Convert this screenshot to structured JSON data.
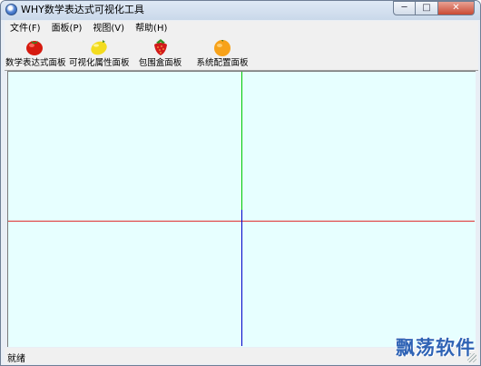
{
  "window": {
    "title": "WHY数学表达式可视化工具"
  },
  "title_buttons": {
    "minimize": "─",
    "maximize": "□",
    "close": "✕"
  },
  "menu": [
    {
      "label": "文件(F)"
    },
    {
      "label": "面板(P)"
    },
    {
      "label": "视图(V)"
    },
    {
      "label": "帮助(H)"
    }
  ],
  "toolbar": [
    {
      "label": "数学表达式面板",
      "icon": "tomato-icon"
    },
    {
      "label": "可视化属性面板",
      "icon": "lemon-icon"
    },
    {
      "label": "包围盒面板",
      "icon": "strawberry-icon"
    },
    {
      "label": "系统配置面板",
      "icon": "orange-icon"
    }
  ],
  "canvas": {
    "background": "#e7ffff",
    "axis_colors": {
      "x": "#e03030",
      "y": "#00c800",
      "z": "#0000c8"
    }
  },
  "status": {
    "text": "就绪"
  },
  "watermark": {
    "text": "飘荡软件"
  }
}
